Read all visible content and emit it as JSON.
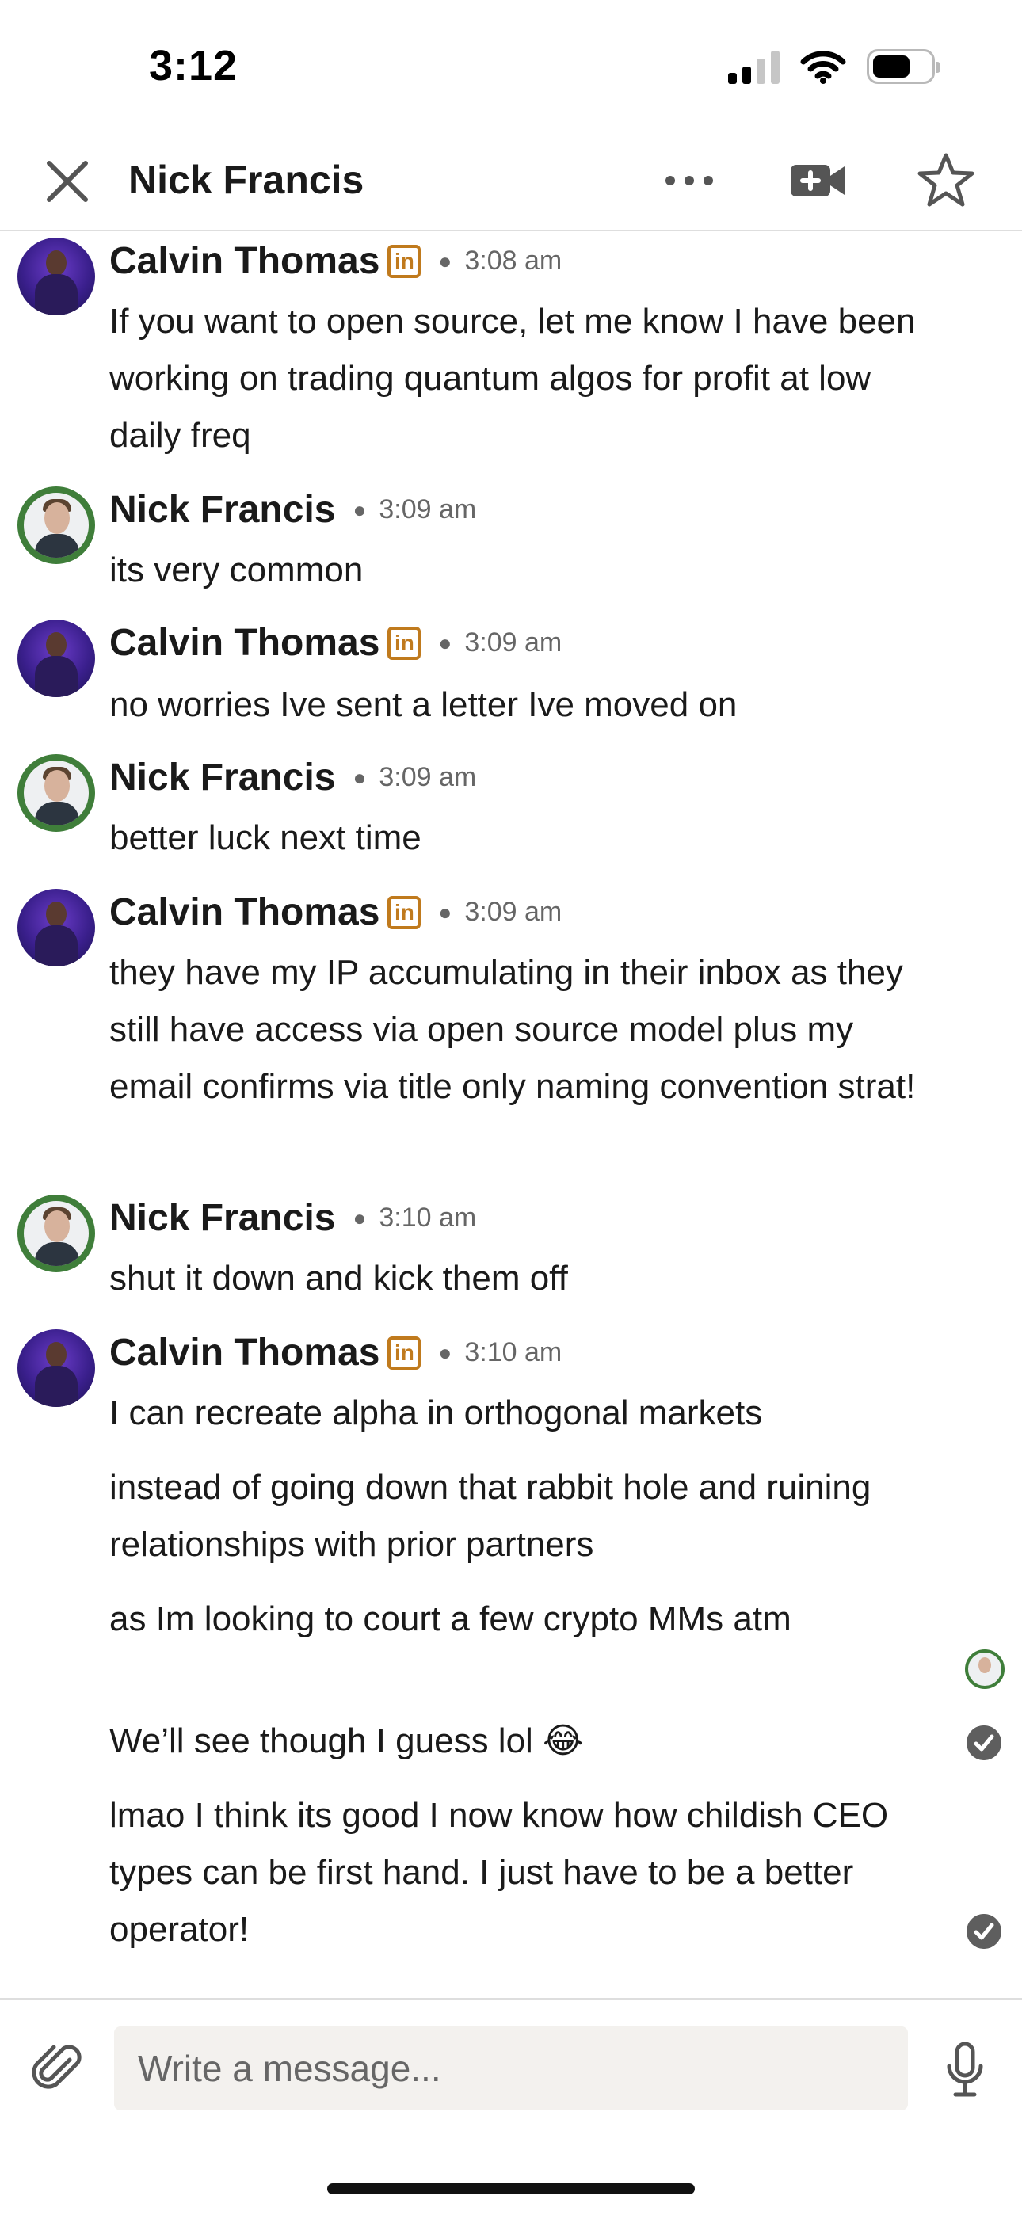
{
  "status_bar": {
    "time": "3:12"
  },
  "header": {
    "title": "Nick Francis"
  },
  "messages": [
    {
      "sender": "Calvin Thomas",
      "badge": "in",
      "time": "3:08 am",
      "lines": [
        "If you want to open source, let me know I have been working on trading quantum algos for profit at low daily freq"
      ]
    },
    {
      "sender": "Nick Francis",
      "time": "3:09 am",
      "lines": [
        "its very common"
      ]
    },
    {
      "sender": "Calvin Thomas",
      "badge": "in",
      "time": "3:09 am",
      "lines": [
        "no worries Ive sent a letter Ive moved on"
      ]
    },
    {
      "sender": "Nick Francis",
      "time": "3:09 am",
      "lines": [
        "better luck next time"
      ]
    },
    {
      "sender": "Calvin Thomas",
      "badge": "in",
      "time": "3:09 am",
      "lines": [
        "they have my IP accumulating in their inbox as they still have access via open source model plus my email confirms via title only naming convention strat!"
      ]
    },
    {
      "sender": "Nick Francis",
      "time": "3:10 am",
      "lines": [
        "shut it down and kick them off"
      ]
    },
    {
      "sender": "Calvin Thomas",
      "badge": "in",
      "time": "3:10 am",
      "lines": [
        "I can recreate alpha in orthogonal markets",
        "instead of going down that rabbit hole and ruining relationships with prior partners",
        "as Im looking to court a few crypto MMs atm",
        "We’ll see though I guess lol 😂",
        "lmao I think its good I now know how childish CEO types can be first hand. I just have to be a better operator!"
      ]
    }
  ],
  "composer": {
    "placeholder": "Write a message..."
  },
  "icons": [
    "close-icon",
    "more-icon",
    "video-call-icon",
    "star-icon",
    "linkedin-icon",
    "read-receipt-avatar",
    "check-icon",
    "attachment-icon",
    "microphone-icon"
  ],
  "colors": {
    "linkedin_badge": "#c07a1d",
    "avatar_ring": "#3f7e3a",
    "divider": "#dedede",
    "input_bg": "#f3f1ee"
  }
}
